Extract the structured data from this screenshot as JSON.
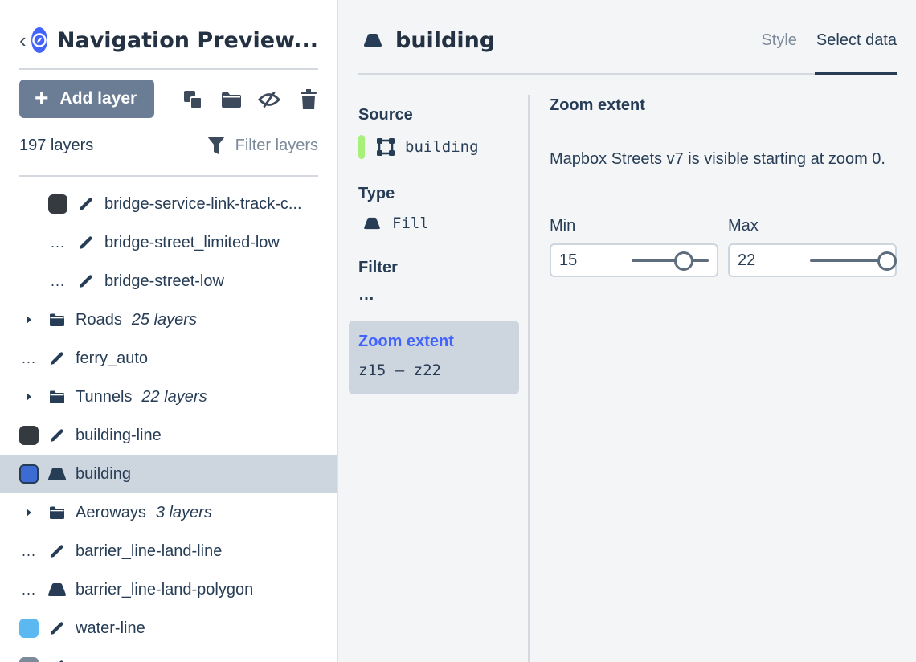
{
  "sidebar": {
    "title": "Navigation Preview...",
    "add_layer_label": "Add layer",
    "layer_count": "197 layers",
    "filter_placeholder": "Filter layers",
    "layers": [
      {
        "name": "bridge-service-link-track-c...",
        "kind": "line",
        "indicator": "swatch",
        "color": "#343a40",
        "indent": true
      },
      {
        "name": "bridge-street_limited-low",
        "kind": "line",
        "indicator": "dots",
        "indent": true
      },
      {
        "name": "bridge-street-low",
        "kind": "line",
        "indicator": "dots",
        "indent": true
      },
      {
        "name": "Roads",
        "kind": "group",
        "count": "25 layers"
      },
      {
        "name": "ferry_auto",
        "kind": "line",
        "indicator": "dots"
      },
      {
        "name": "Tunnels",
        "kind": "group",
        "count": "22 layers"
      },
      {
        "name": "building-line",
        "kind": "line",
        "indicator": "swatch",
        "color": "#343a40"
      },
      {
        "name": "building",
        "kind": "fill",
        "indicator": "swatch",
        "color": "#3d6bd4",
        "selected": true
      },
      {
        "name": "Aeroways",
        "kind": "group",
        "count": "3 layers"
      },
      {
        "name": "barrier_line-land-line",
        "kind": "line",
        "indicator": "dots"
      },
      {
        "name": "barrier_line-land-polygon",
        "kind": "fill",
        "indicator": "dots"
      },
      {
        "name": "water-line",
        "kind": "line",
        "indicator": "swatch",
        "color": "#5bb8f0"
      },
      {
        "name": "",
        "kind": "line",
        "indicator": "swatch",
        "color": "#7c8a9a"
      }
    ]
  },
  "header": {
    "title": "building",
    "tabs": [
      {
        "label": "Style",
        "active": false
      },
      {
        "label": "Select data",
        "active": true
      }
    ]
  },
  "properties": {
    "source_label": "Source",
    "source_value": "building",
    "type_label": "Type",
    "type_value": "Fill",
    "filter_label": "Filter",
    "filter_value": "…",
    "zoom_label": "Zoom extent",
    "zoom_value": "z15 – z22"
  },
  "zoom_panel": {
    "title": "Zoom extent",
    "description": "Mapbox Streets v7 is visible starting at zoom 0.",
    "min_label": "Min",
    "max_label": "Max",
    "min_value": "15",
    "max_value": "22",
    "slider_min": 0,
    "slider_max": 22
  },
  "colors": {
    "accent": "#4264fb",
    "selected_row": "#cdd5df",
    "source_indicator": "#a7f07a"
  }
}
